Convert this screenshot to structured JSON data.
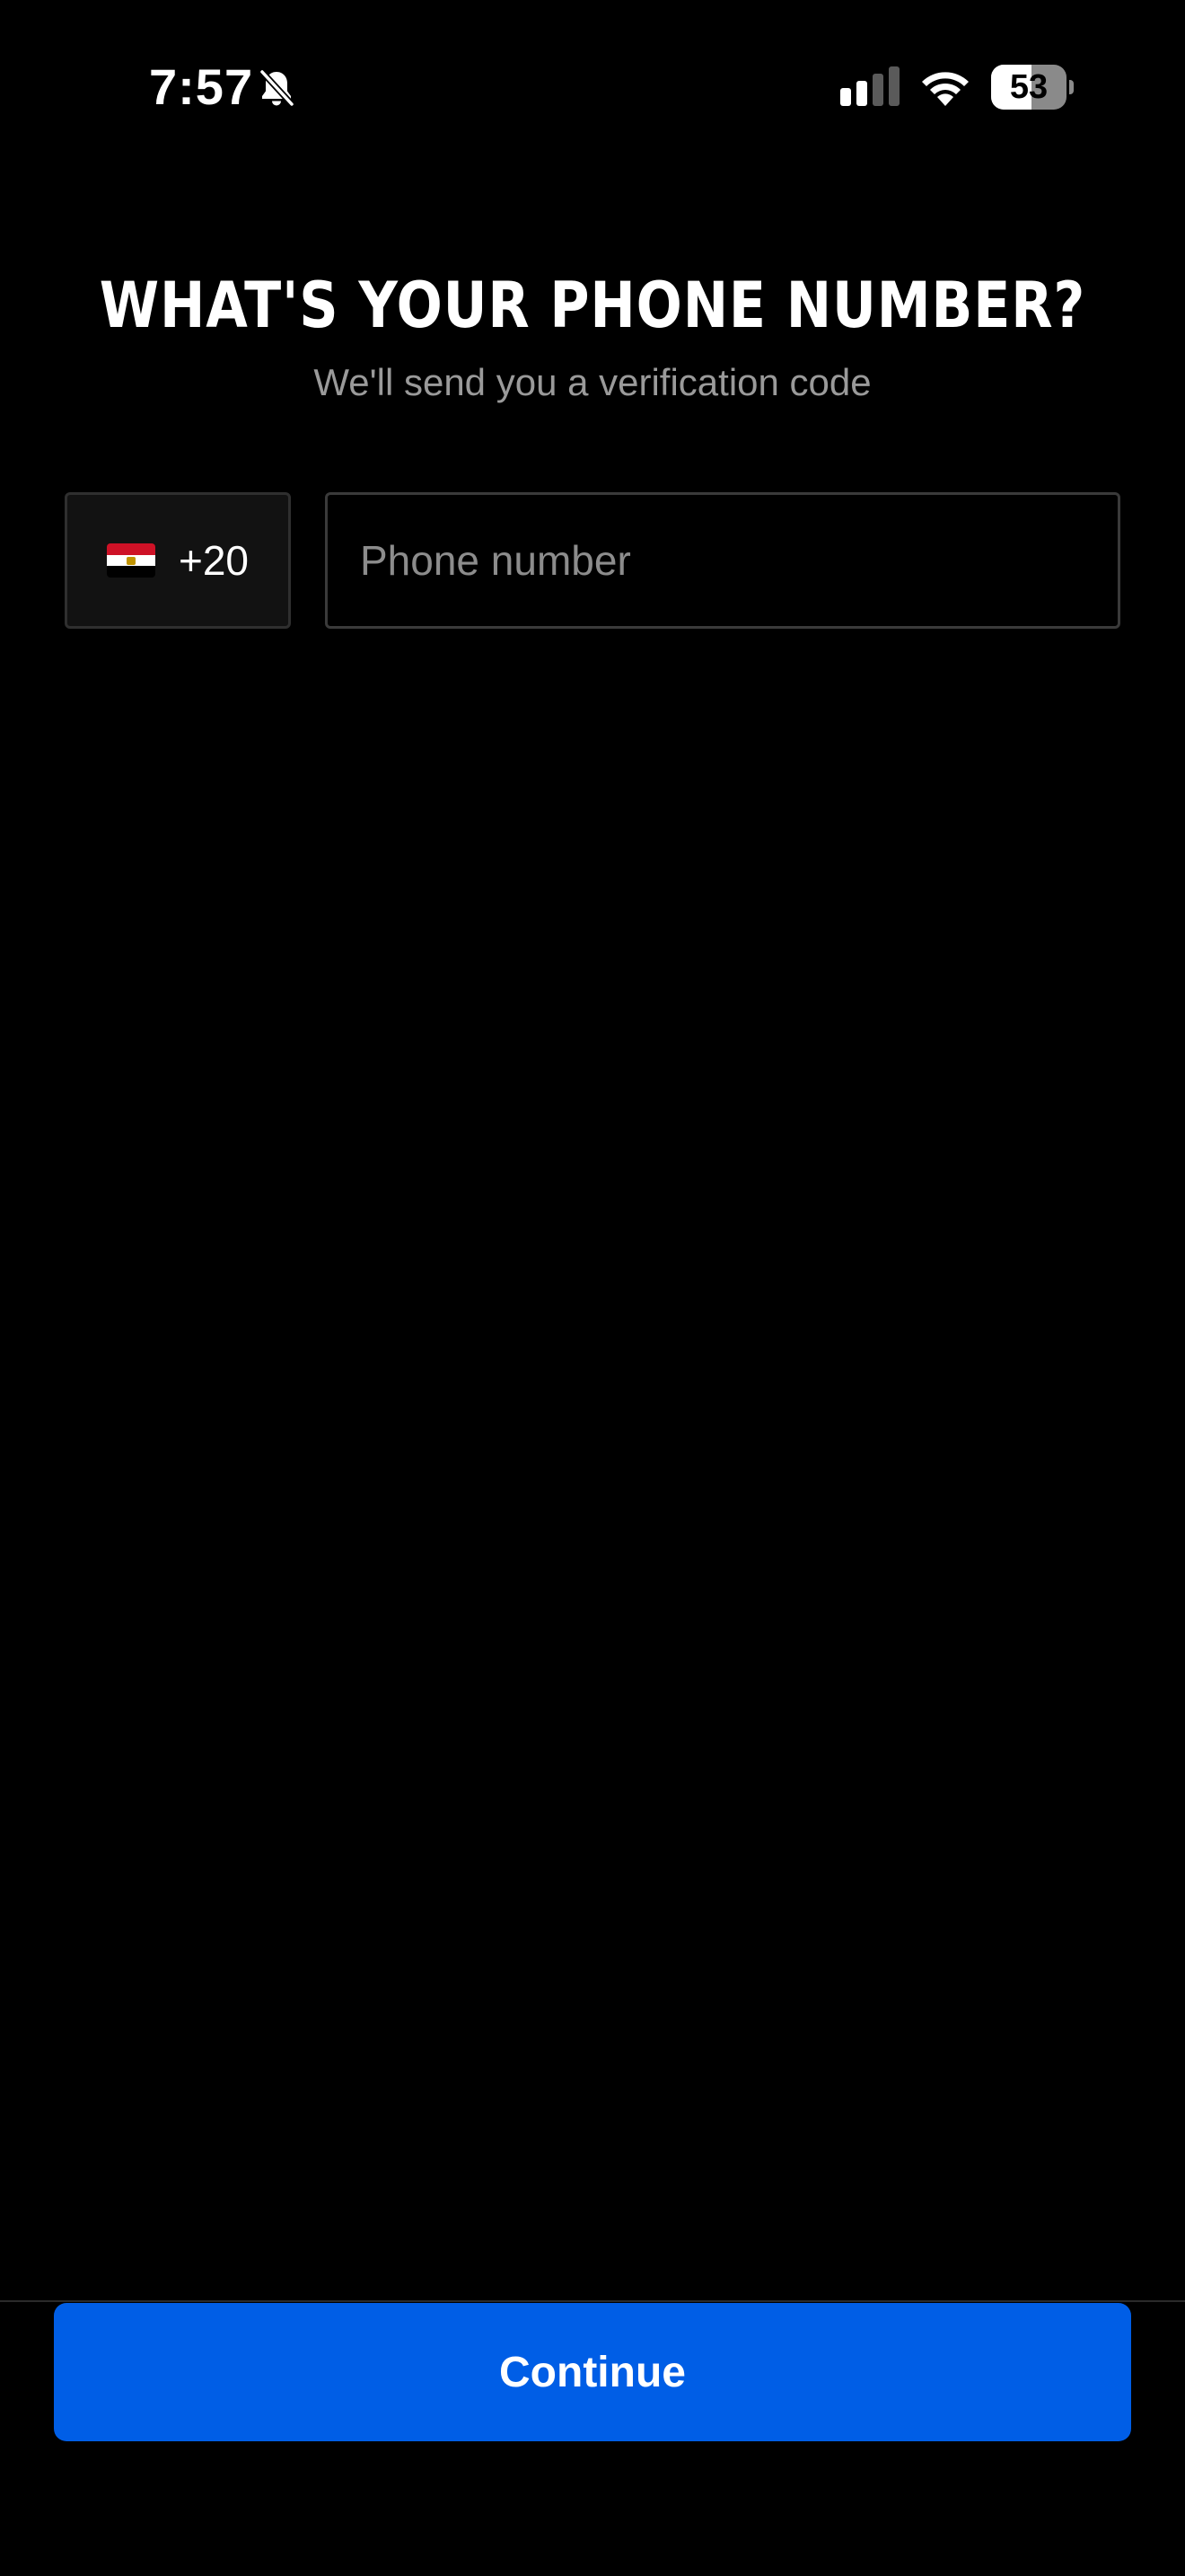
{
  "status_bar": {
    "time": "7:57",
    "battery_level": "53",
    "battery_fraction": 0.53,
    "icons": [
      "bell-slash-icon",
      "cellular-signal-icon",
      "wifi-icon",
      "battery-icon"
    ]
  },
  "heading": {
    "title": "WHAT'S YOUR PHONE NUMBER?",
    "subtitle": "We'll send you a verification code"
  },
  "country_selector": {
    "flag": "egypt-flag-icon",
    "code": "+20"
  },
  "phone_field": {
    "value": "",
    "placeholder": "Phone number"
  },
  "actions": {
    "continue_label": "Continue"
  },
  "colors": {
    "background": "#000000",
    "accent": "#005ee6",
    "subtitle": "#9a9a9a",
    "placeholder": "#8c8c8c"
  }
}
